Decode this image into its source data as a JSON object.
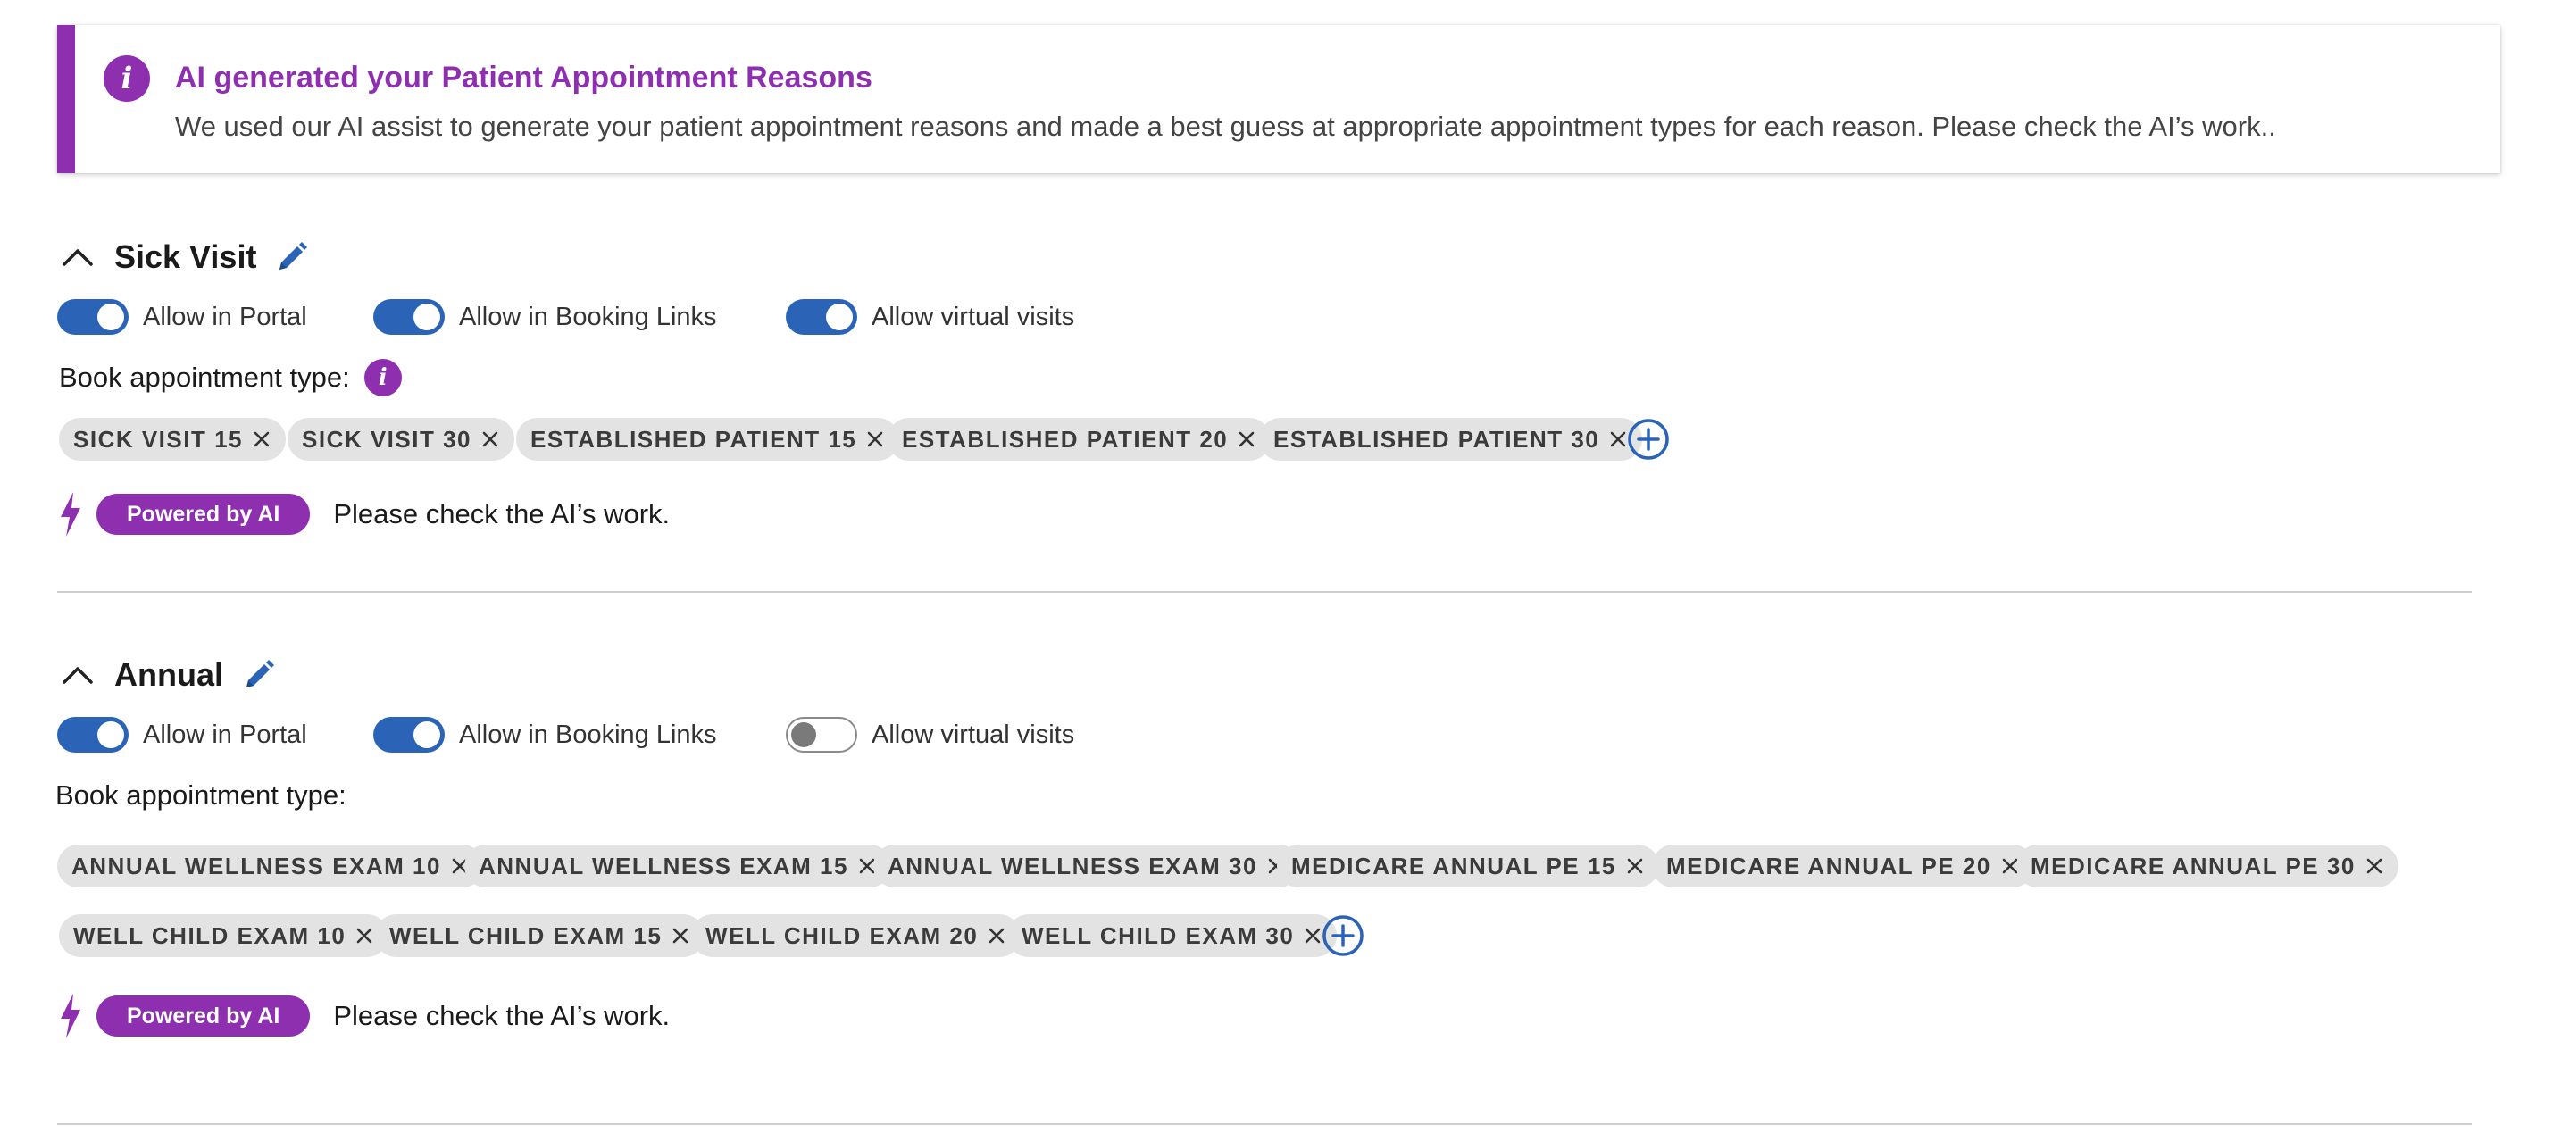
{
  "banner": {
    "title": "AI generated your Patient Appointment Reasons",
    "text": "We used our AI assist to generate your patient appointment reasons and made a best guess at appropriate appointment types for each reason. Please check the AI’s work..",
    "icon": "info-icon",
    "accent_color": "#8e2fb0"
  },
  "sections": [
    {
      "title": "Sick Visit",
      "toggles": [
        {
          "label": "Allow in Portal",
          "on": true
        },
        {
          "label": "Allow in Booking Links",
          "on": true
        },
        {
          "label": "Allow virtual visits",
          "on": true
        }
      ],
      "book_label": "Book appointment type:",
      "types": [
        "SICK VISIT 15",
        "SICK VISIT 30",
        "ESTABLISHED PATIENT 15",
        "ESTABLISHED PATIENT 20",
        "ESTABLISHED PATIENT 30"
      ],
      "ai_badge": "Powered by AI",
      "ai_note": "Please check the AI’s work."
    },
    {
      "title": "Annual",
      "toggles": [
        {
          "label": "Allow in Portal",
          "on": true
        },
        {
          "label": "Allow in Booking Links",
          "on": true
        },
        {
          "label": "Allow virtual visits",
          "on": false
        }
      ],
      "book_label": "Book appointment type:",
      "types": [
        "ANNUAL WELLNESS EXAM 10",
        "ANNUAL WELLNESS EXAM 15",
        "ANNUAL WELLNESS EXAM 30",
        "MEDICARE ANNUAL PE 15",
        "MEDICARE ANNUAL PE 20",
        "MEDICARE ANNUAL PE 30",
        "WELL CHILD EXAM 10",
        "WELL CHILD EXAM 15",
        "WELL CHILD EXAM 20",
        "WELL CHILD EXAM 30"
      ],
      "ai_badge": "Powered by AI",
      "ai_note": "Please check the AI’s work."
    }
  ],
  "colors": {
    "primary_blue": "#2b64b7",
    "ai_purple": "#8e2fb0",
    "chip_bg": "#e3e3e3"
  }
}
